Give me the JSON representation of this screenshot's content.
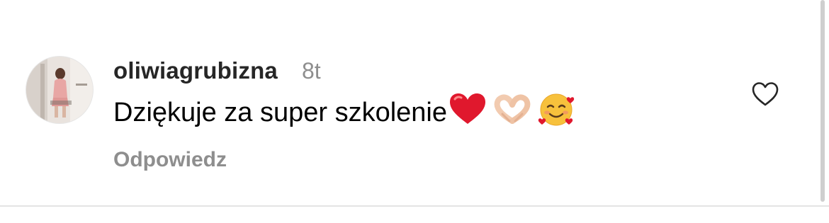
{
  "comment": {
    "username": "oliwiagrubizna",
    "timestamp": "8t",
    "text": "Dziękuje za super szkolenie",
    "emojis": [
      "❤️",
      "🫶🏻",
      "🥰"
    ],
    "reply_label": "Odpowiedz",
    "liked": false
  },
  "colors": {
    "username": "#262626",
    "secondary": "#8e8e8e",
    "heart_outline": "#262626",
    "divider": "#e4e4e4"
  },
  "icons": {
    "like": "heart-outline-icon"
  }
}
